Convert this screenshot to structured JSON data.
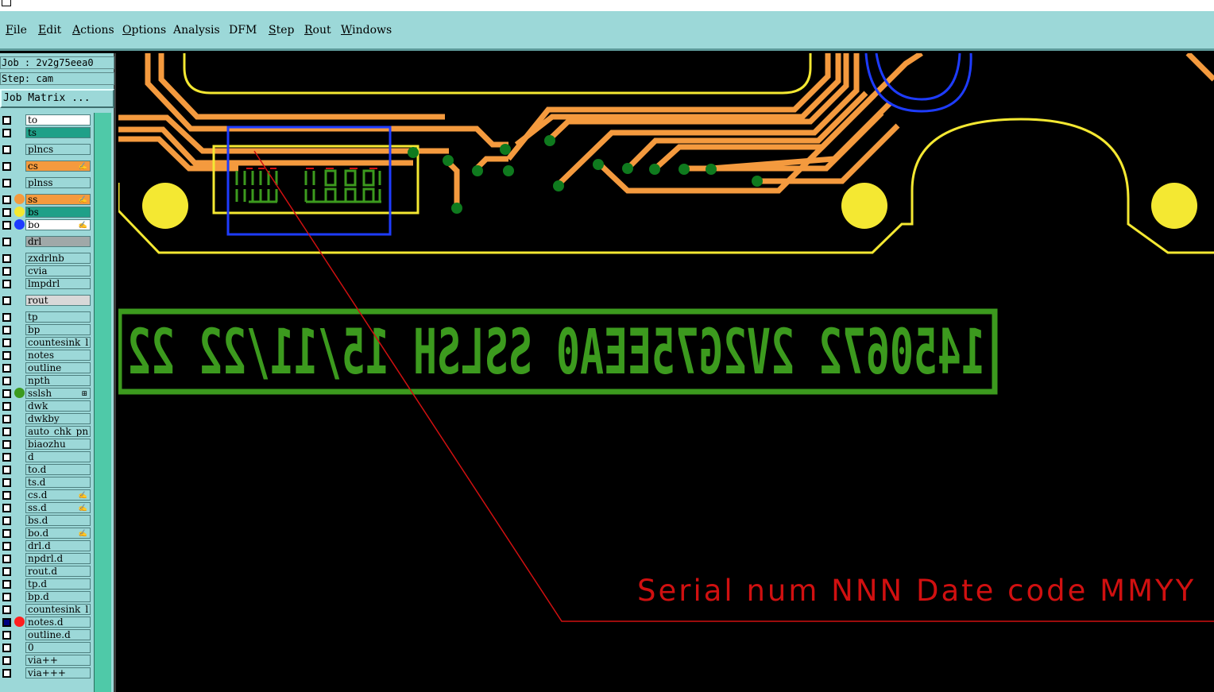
{
  "menu": [
    {
      "label": "File",
      "underline": "F",
      "rest": "ile"
    },
    {
      "label": "Edit",
      "underline": "E",
      "rest": "dit"
    },
    {
      "label": "Actions",
      "underline": "A",
      "rest": "ctions"
    },
    {
      "label": "Options",
      "underline": "O",
      "rest": "ptions"
    },
    {
      "label": "Analysis",
      "underline": "",
      "rest": "Analysis"
    },
    {
      "label": "DFM",
      "underline": "",
      "rest": "DFM"
    },
    {
      "label": "Step",
      "underline": "S",
      "rest": "tep"
    },
    {
      "label": "Rout",
      "underline": "R",
      "rest": "out"
    },
    {
      "label": "Windows",
      "underline": "W",
      "rest": "indows"
    }
  ],
  "job": {
    "text": "Job : 2v2g75eea0"
  },
  "step": {
    "text": "Step: cam"
  },
  "job_matrix_button": "Job Matrix ...",
  "layers": [
    {
      "name": "to",
      "bg": "#ffffff"
    },
    {
      "name": "ts",
      "bg": "#1fa088"
    },
    {
      "name": "plncs",
      "bg": "#9cd8d8",
      "gap": true
    },
    {
      "name": "cs",
      "bg": "#f49a3e",
      "flag": "✍",
      "gap": true
    },
    {
      "name": "plnss",
      "bg": "#9cd8d8",
      "gap": true
    },
    {
      "name": "ss",
      "bg": "#f49a3e",
      "dot": "#f49a3e",
      "flag": "✍",
      "gap": true
    },
    {
      "name": "bs",
      "bg": "#1fa088",
      "dot": "#f4e832"
    },
    {
      "name": "bo",
      "bg": "#ffffff",
      "dot": "#1e3cff",
      "flag": "✍"
    },
    {
      "name": "drl",
      "bg": "#a0a8a8",
      "gap": true
    },
    {
      "name": "zxdrlnb",
      "bg": "#9cd8d8",
      "gap": true
    },
    {
      "name": "cvia",
      "bg": "#9cd8d8"
    },
    {
      "name": "lmpdrl",
      "bg": "#9cd8d8"
    },
    {
      "name": "rout",
      "bg": "#d8d8d8",
      "gap": true
    },
    {
      "name": "tp",
      "bg": "#9cd8d8",
      "gap": true
    },
    {
      "name": "bp",
      "bg": "#9cd8d8"
    },
    {
      "name": "countesink_l",
      "bg": "#9cd8d8"
    },
    {
      "name": "notes",
      "bg": "#9cd8d8"
    },
    {
      "name": "outline",
      "bg": "#9cd8d8"
    },
    {
      "name": "npth",
      "bg": "#9cd8d8"
    },
    {
      "name": "sslsh",
      "bg": "#9cd8d8",
      "dot": "#3c9a1e",
      "flag": "⊞"
    },
    {
      "name": "dwk",
      "bg": "#9cd8d8"
    },
    {
      "name": "dwkby",
      "bg": "#9cd8d8"
    },
    {
      "name": "auto_chk_pn",
      "bg": "#9cd8d8"
    },
    {
      "name": "biaozhu",
      "bg": "#9cd8d8"
    },
    {
      "name": "d",
      "bg": "#9cd8d8"
    },
    {
      "name": "to.d",
      "bg": "#9cd8d8"
    },
    {
      "name": "ts.d",
      "bg": "#9cd8d8"
    },
    {
      "name": "cs.d",
      "bg": "#9cd8d8",
      "flag": "✍"
    },
    {
      "name": "ss.d",
      "bg": "#9cd8d8",
      "flag": "✍"
    },
    {
      "name": "bs.d",
      "bg": "#9cd8d8"
    },
    {
      "name": "bo.d",
      "bg": "#9cd8d8",
      "flag": "✍"
    },
    {
      "name": "drl.d",
      "bg": "#9cd8d8"
    },
    {
      "name": "npdrl.d",
      "bg": "#9cd8d8"
    },
    {
      "name": "rout.d",
      "bg": "#9cd8d8"
    },
    {
      "name": "tp.d",
      "bg": "#9cd8d8"
    },
    {
      "name": "bp.d",
      "bg": "#9cd8d8"
    },
    {
      "name": "countesink_l",
      "bg": "#9cd8d8"
    },
    {
      "name": "notes.d",
      "bg": "#9cd8d8",
      "dot": "#ff1e1e",
      "checked": true
    },
    {
      "name": "outline.d",
      "bg": "#9cd8d8"
    },
    {
      "name": "0",
      "bg": "#9cd8d8"
    },
    {
      "name": "via++",
      "bg": "#9cd8d8"
    },
    {
      "name": "via+++",
      "bg": "#9cd8d8"
    }
  ],
  "canvas": {
    "mirrored_text": "1450672  2V2G75EEA0 SSLSH 15/11/22 22",
    "note_text": "Serial num NNN Date code MMYY",
    "colors": {
      "trace": "#f49a3e",
      "outline": "#f4e832",
      "pad": "#f4e832",
      "via": "#0f7a1e",
      "silk": "#3c9a1e",
      "annotation": "#d01010",
      "blue": "#1e3cff"
    }
  }
}
